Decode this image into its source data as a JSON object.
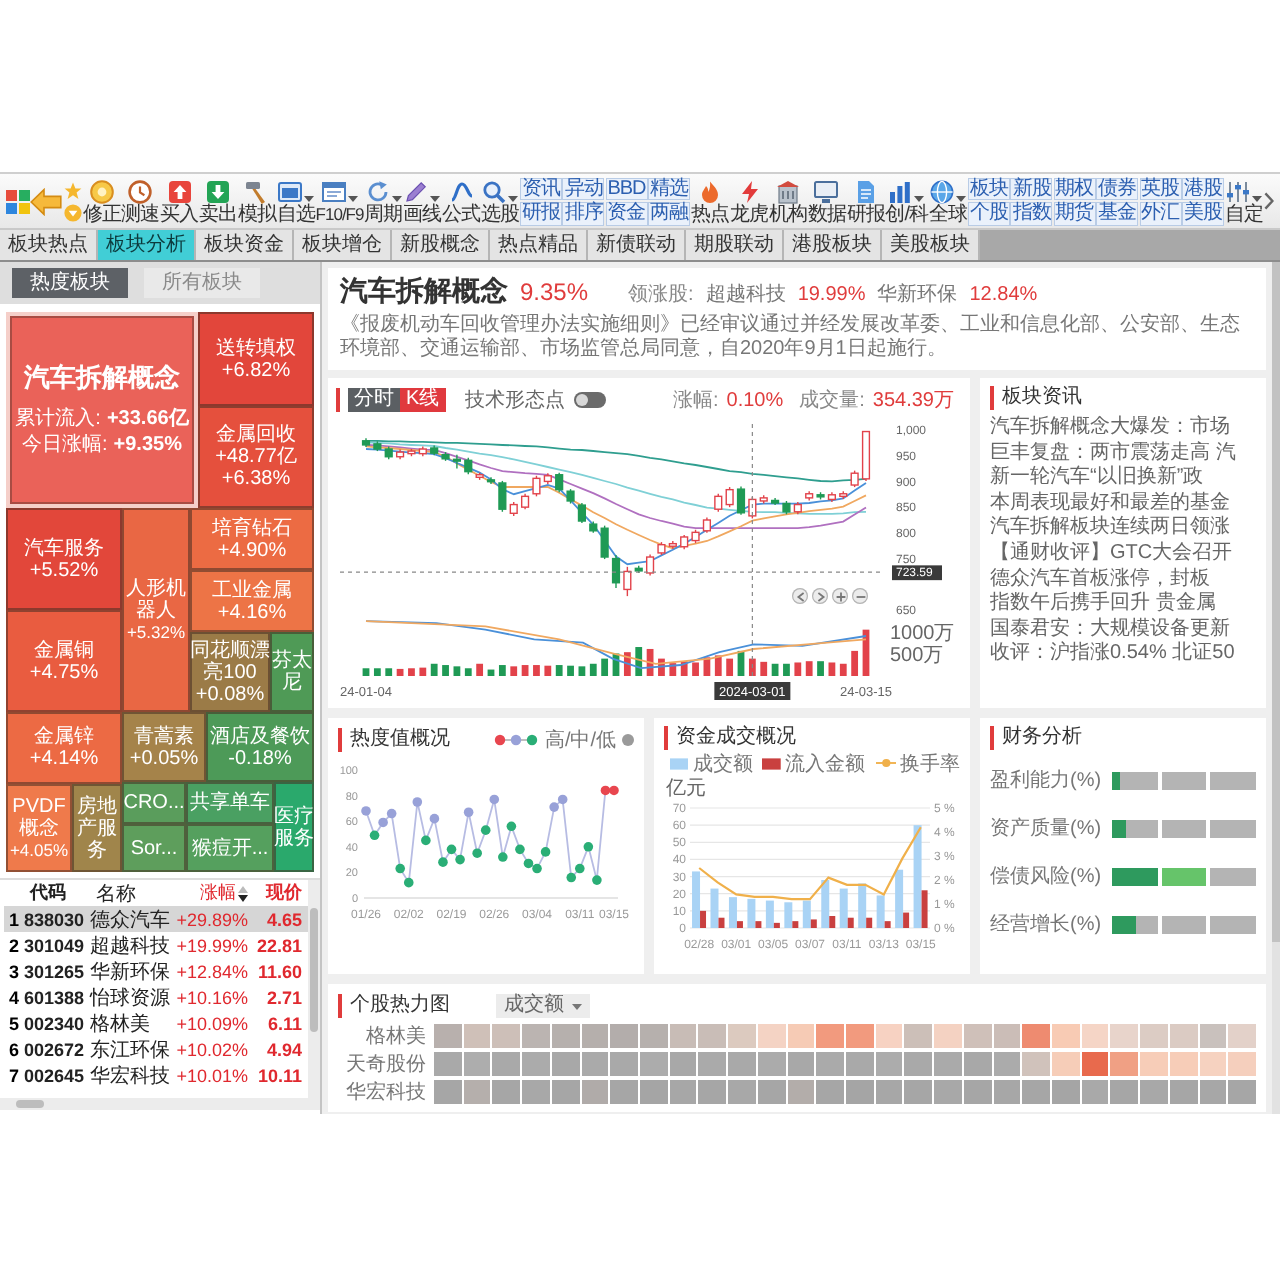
{
  "toolbar": {
    "items": [
      {
        "kind": "tool",
        "label": "修正",
        "menu": false
      },
      {
        "kind": "tool",
        "label": "测速",
        "menu": false
      },
      {
        "kind": "tool",
        "label": "买入",
        "menu": false
      },
      {
        "kind": "tool",
        "label": "卖出",
        "menu": false
      },
      {
        "kind": "tool",
        "label": "模拟",
        "menu": false
      },
      {
        "kind": "tool",
        "label": "自选",
        "menu": true
      },
      {
        "kind": "tool",
        "label": "F10/F9",
        "menu": true
      },
      {
        "kind": "tool",
        "label": "周期",
        "menu": true
      },
      {
        "kind": "tool",
        "label": "画线",
        "menu": true
      },
      {
        "kind": "tool",
        "label": "公式",
        "menu": false
      },
      {
        "kind": "tool",
        "label": "选股",
        "menu": true
      },
      {
        "kind": "pair",
        "labels": [
          "资讯",
          "研报"
        ]
      },
      {
        "kind": "pair",
        "labels": [
          "异动",
          "排序"
        ]
      },
      {
        "kind": "pair",
        "labels": [
          "BBD",
          "资金"
        ]
      },
      {
        "kind": "pair",
        "labels": [
          "精选",
          "两融"
        ]
      },
      {
        "kind": "tool",
        "label": "热点",
        "menu": false
      },
      {
        "kind": "tool",
        "label": "龙虎",
        "menu": false
      },
      {
        "kind": "tool",
        "label": "机构",
        "menu": false
      },
      {
        "kind": "tool",
        "label": "数据",
        "menu": false
      },
      {
        "kind": "tool",
        "label": "研报",
        "menu": false
      },
      {
        "kind": "tool",
        "label": "创/科",
        "menu": true
      },
      {
        "kind": "tool",
        "label": "全球",
        "menu": true
      },
      {
        "kind": "pair",
        "labels": [
          "板块",
          "个股"
        ]
      },
      {
        "kind": "pair",
        "labels": [
          "新股",
          "指数"
        ]
      },
      {
        "kind": "pair",
        "labels": [
          "期权",
          "期货"
        ]
      },
      {
        "kind": "pair",
        "labels": [
          "债券",
          "基金"
        ]
      },
      {
        "kind": "pair",
        "labels": [
          "英股",
          "外汇"
        ]
      },
      {
        "kind": "pair",
        "labels": [
          "港股",
          "美股"
        ]
      },
      {
        "kind": "tool",
        "label": "自定",
        "menu": true
      }
    ]
  },
  "tabs": [
    {
      "label": "板块热点",
      "selected": false
    },
    {
      "label": "板块分析",
      "selected": true
    },
    {
      "label": "板块资金",
      "selected": false
    },
    {
      "label": "板块增仓",
      "selected": false
    },
    {
      "label": "新股概念",
      "selected": false
    },
    {
      "label": "热点精品",
      "selected": false
    },
    {
      "label": "新债联动",
      "selected": false
    },
    {
      "label": "期股联动",
      "selected": false
    },
    {
      "label": "港股板块",
      "selected": false
    },
    {
      "label": "美股板块",
      "selected": false
    }
  ],
  "left_panel": {
    "tabs": [
      {
        "label": "热度板块",
        "selected": true
      },
      {
        "label": "所有板块",
        "selected": false
      }
    ],
    "treemap": [
      {
        "name": "汽车拆解概念",
        "color": "#ea6259",
        "selected": true,
        "stats": [
          {
            "label": "累计流入:",
            "value": "+33.66亿"
          },
          {
            "label": "今日涨幅:",
            "value": "+9.35%"
          }
        ]
      },
      {
        "name": "送转填权",
        "color": "#e2463b",
        "selected": false,
        "values": [
          "+6.82%"
        ]
      },
      {
        "name": "金属回收",
        "color": "#e5503d",
        "selected": false,
        "values": [
          "+48.77亿",
          "+6.38%"
        ]
      },
      {
        "name": "汽车服务",
        "color": "#e2473a",
        "selected": false,
        "values": [
          "+5.52%"
        ]
      },
      {
        "name": "人形机器人",
        "color": "#e96744",
        "selected": false,
        "values": [
          "+5.32%"
        ]
      },
      {
        "name": "培育钻石",
        "color": "#ec6b43",
        "selected": false,
        "values": [
          "+4.90%"
        ]
      },
      {
        "name": "工业金属",
        "color": "#ed7446",
        "selected": false,
        "values": [
          "+4.16%"
        ]
      },
      {
        "name": "金属铜",
        "color": "#e95c40",
        "selected": false,
        "values": [
          "+4.75%"
        ]
      },
      {
        "name": "同花顺漂亮100",
        "color": "#9b7b47",
        "selected": false,
        "values": [
          "+0.08%"
        ]
      },
      {
        "name": "芬太尼",
        "color": "#4f9a56",
        "selected": false
      },
      {
        "name": "金属锌",
        "color": "#ec6a44",
        "selected": false,
        "values": [
          "+4.14%"
        ]
      },
      {
        "name": "青蒿素",
        "color": "#a5834a",
        "selected": false,
        "values": [
          "+0.05%"
        ]
      },
      {
        "name": "酒店及餐饮",
        "color": "#4d9a58",
        "selected": false,
        "values": [
          "-0.18%"
        ]
      },
      {
        "name": "PVDF概念",
        "color": "#ef7a4b",
        "selected": false,
        "values": [
          "+4.05%"
        ]
      },
      {
        "name": "房地产服务",
        "color": "#a0854b",
        "selected": false
      },
      {
        "name": "CRO...",
        "color": "#5a9d5c",
        "selected": false
      },
      {
        "name": "共享单车",
        "color": "#4aa062",
        "selected": false
      },
      {
        "name": "医疗服务",
        "color": "#2aa96c",
        "selected": false
      },
      {
        "name": "Sor...",
        "color": "#5e9e5c",
        "selected": false
      },
      {
        "name": "猴痘开...",
        "color": "#55a05e",
        "selected": false
      }
    ],
    "stocks": {
      "columns": [
        {
          "label": "代码",
          "sorted": false
        },
        {
          "label": "名称",
          "sorted": false
        },
        {
          "label": "涨幅",
          "sorted": true
        },
        {
          "label": "现价",
          "sorted": false
        }
      ],
      "rows": [
        {
          "index": "1",
          "code": "838030",
          "name": "德众汽车",
          "change": "+29.89%",
          "price": "4.65",
          "selected": true
        },
        {
          "index": "2",
          "code": "301049",
          "name": "超越科技",
          "change": "+19.99%",
          "price": "22.81",
          "selected": false
        },
        {
          "index": "3",
          "code": "301265",
          "name": "华新环保",
          "change": "+12.84%",
          "price": "11.60",
          "selected": false
        },
        {
          "index": "4",
          "code": "601388",
          "name": "怡球资源",
          "change": "+10.16%",
          "price": "2.71",
          "selected": false
        },
        {
          "index": "5",
          "code": "002340",
          "name": "格林美",
          "change": "+10.09%",
          "price": "6.11",
          "selected": false
        },
        {
          "index": "6",
          "code": "002672",
          "name": "东江环保",
          "change": "+10.02%",
          "price": "4.94",
          "selected": false
        },
        {
          "index": "7",
          "code": "002645",
          "name": "华宏科技",
          "change": "+10.01%",
          "price": "10.11",
          "selected": false
        }
      ]
    }
  },
  "board": {
    "title": "汽车拆解概念",
    "change": "9.35%",
    "leaders_label": "领涨股:",
    "leaders": [
      {
        "name": "超越科技",
        "change": "19.99%"
      },
      {
        "name": "华新环保",
        "change": "12.84%"
      }
    ],
    "description": "《报废机动车回收管理办法实施细则》已经审议通过并经发展改革委、工业和信息化部、公安部、生态环境部、交通运输部、市场监管总局同意，自2020年9月1日起施行。"
  },
  "kline": {
    "modes": [
      {
        "label": "分时",
        "selected": false
      },
      {
        "label": "K线",
        "selected": true
      }
    ],
    "pattern_toggle": {
      "label": "技术形态点",
      "on": false
    },
    "stats": [
      {
        "label": "涨幅:",
        "value": "0.10%"
      },
      {
        "label": "成交量:",
        "value": "354.39万"
      }
    ],
    "volume_labels": [
      "1000万",
      "500万"
    ],
    "cursor_price": "723.59",
    "cursor_date": "2024-03-01",
    "chart_data": {
      "type": "candlestick",
      "categories": [
        "24-01-04",
        null,
        null,
        null,
        null,
        null,
        null,
        null,
        null,
        null,
        null,
        null,
        null,
        null,
        null,
        null,
        null,
        null,
        null,
        null,
        null,
        null,
        null,
        null,
        null,
        null,
        null,
        null,
        null,
        null,
        null,
        null,
        null,
        null,
        null,
        null,
        null,
        null,
        null,
        null,
        null,
        null,
        null,
        null,
        "24-03-15"
      ],
      "ohlc": [
        [
          979,
          984,
          967,
          971
        ],
        [
          973,
          978,
          959,
          963
        ],
        [
          963,
          968,
          943,
          948
        ],
        [
          948,
          962,
          943,
          957
        ],
        [
          954,
          963,
          949,
          959
        ],
        [
          954,
          968,
          949,
          963
        ],
        [
          965,
          970,
          951,
          955
        ],
        [
          952,
          957,
          940,
          944
        ],
        [
          943,
          952,
          925,
          940
        ],
        [
          941,
          946,
          914,
          919
        ],
        [
          908,
          917,
          903,
          913
        ],
        [
          903,
          908,
          895,
          900
        ],
        [
          897,
          901,
          841,
          846
        ],
        [
          838,
          860,
          833,
          855
        ],
        [
          850,
          876,
          846,
          871
        ],
        [
          876,
          911,
          871,
          906
        ],
        [
          900,
          916,
          895,
          911
        ],
        [
          913,
          917,
          879,
          884
        ],
        [
          881,
          885,
          857,
          862
        ],
        [
          854,
          858,
          819,
          823
        ],
        [
          817,
          822,
          800,
          804
        ],
        [
          809,
          814,
          749,
          753
        ],
        [
          750,
          757,
          693,
          703
        ],
        [
          690,
          734,
          677,
          725
        ],
        [
          731,
          736,
          722,
          726
        ],
        [
          722,
          758,
          717,
          753
        ],
        [
          761,
          782,
          757,
          777
        ],
        [
          774,
          784,
          769,
          779
        ],
        [
          773,
          796,
          768,
          792
        ],
        [
          785,
          806,
          780,
          801
        ],
        [
          804,
          830,
          800,
          825
        ],
        [
          846,
          876,
          841,
          871
        ],
        [
          855,
          889,
          850,
          884
        ],
        [
          885,
          890,
          835,
          839
        ],
        [
          833,
          870,
          828,
          865
        ],
        [
          862,
          873,
          857,
          868
        ],
        [
          863,
          868,
          854,
          858
        ],
        [
          857,
          862,
          836,
          841
        ],
        [
          841,
          860,
          836,
          855
        ],
        [
          868,
          881,
          863,
          876
        ],
        [
          874,
          879,
          865,
          870
        ],
        [
          865,
          879,
          860,
          874
        ],
        [
          871,
          881,
          866,
          876
        ],
        [
          893,
          921,
          889,
          916
        ],
        [
          905,
          998,
          901,
          997
        ]
      ],
      "ylim": [
        650,
        1000
      ],
      "yticks": [
        {
          "value": 1000,
          "label": "1,000"
        },
        {
          "value": 950,
          "label": "950"
        },
        {
          "value": 900,
          "label": "900"
        },
        {
          "value": 850,
          "label": "850"
        },
        {
          "value": 800,
          "label": "800"
        },
        {
          "value": 750,
          "label": "750"
        },
        {
          "value": 650,
          "label": "650"
        }
      ],
      "series": [
        {
          "type": "line",
          "color": "#2f9e8f",
          "values": [
            979,
            979,
            978,
            978,
            977,
            977,
            976,
            975,
            975,
            974,
            973,
            972,
            971,
            970,
            969,
            968,
            966,
            964,
            962,
            961,
            959,
            957,
            955,
            953,
            950,
            946,
            943,
            939,
            935,
            932,
            928,
            924,
            920,
            918,
            915,
            913,
            910,
            908,
            906,
            903,
            901,
            900,
            902,
            903,
            905
          ]
        },
        {
          "type": "line",
          "color": "#7fd0d6",
          "values": [
            976,
            975,
            974,
            972,
            971,
            970,
            969,
            965,
            962,
            958,
            954,
            951,
            947,
            943,
            938,
            933,
            928,
            923,
            918,
            913,
            907,
            901,
            895,
            888,
            882,
            876,
            870,
            865,
            859,
            854,
            849,
            847,
            845,
            843,
            841,
            840,
            840,
            839,
            838,
            837,
            837,
            837,
            838,
            840,
            841
          ]
        },
        {
          "type": "line",
          "color": "#b070c0",
          "values": [
            971,
            970,
            968,
            966,
            964,
            962,
            961,
            955,
            948,
            941,
            933,
            926,
            920,
            918,
            916,
            915,
            913,
            904,
            895,
            886,
            877,
            867,
            856,
            846,
            836,
            829,
            823,
            818,
            812,
            809,
            809,
            809,
            809,
            809,
            809,
            809,
            809,
            809,
            809,
            811,
            814,
            818,
            822,
            836,
            849
          ]
        },
        {
          "type": "line",
          "color": "#f0a860",
          "values": [
            968,
            966,
            965,
            963,
            961,
            959,
            957,
            948,
            935,
            923,
            911,
            899,
            889,
            889,
            889,
            889,
            889,
            878,
            865,
            853,
            840,
            829,
            817,
            806,
            796,
            786,
            777,
            770,
            775,
            779,
            784,
            793,
            803,
            813,
            824,
            828,
            832,
            836,
            839,
            842,
            845,
            847,
            851,
            862,
            873
          ]
        },
        {
          "type": "line",
          "color": "#4a90d9",
          "values": [
            963,
            962,
            960,
            958,
            956,
            955,
            953,
            945,
            936,
            927,
            917,
            904,
            885,
            875,
            881,
            887,
            893,
            886,
            863,
            839,
            816,
            785,
            754,
            739,
            742,
            745,
            756,
            767,
            779,
            792,
            806,
            819,
            833,
            844,
            855,
            857,
            857,
            857,
            857,
            858,
            861,
            863,
            867,
            882,
            897
          ]
        }
      ]
    }
  },
  "news": {
    "title": "板块资讯",
    "items": [
      "汽车拆解概念大爆发：市场",
      "巨丰复盘：两市震荡走高 汽",
      "新一轮汽车“以旧换新”政",
      "本周表现最好和最差的基金",
      "汽车拆解板块连续两日领涨",
      "【通财收评】GTC大会召开",
      "德众汽车首板涨停，封板",
      "指数午后携手回升 贵金属",
      "国泰君安：大规模设备更新",
      "收评：沪指涨0.54% 北证50"
    ]
  },
  "heat": {
    "title": "热度值概况",
    "legend": "高/中/低",
    "chart_data": {
      "type": "line",
      "marker": "circle",
      "categories": [
        "01/26",
        null,
        null,
        null,
        null,
        "02/02",
        null,
        null,
        null,
        null,
        "02/19",
        null,
        null,
        null,
        null,
        "02/26",
        null,
        null,
        null,
        null,
        "03/04",
        null,
        null,
        null,
        null,
        "03/11",
        null,
        null,
        null,
        "03/15"
      ],
      "values": [
        68,
        49,
        59,
        66,
        23,
        12,
        75,
        45,
        62,
        28,
        38,
        30,
        67,
        35,
        53,
        77,
        32,
        56,
        38,
        27,
        23,
        36,
        71,
        77,
        16,
        23,
        40,
        14,
        84,
        84
      ],
      "ylim": [
        0,
        100
      ],
      "yticks": [
        0,
        20,
        40,
        60,
        80,
        100
      ]
    }
  },
  "funds": {
    "title": "资金成交概况",
    "chart_data": {
      "type": "bar",
      "grid": true,
      "ylabel": "亿元",
      "categories": [
        "02/28",
        null,
        "03/01",
        null,
        "03/05",
        null,
        "03/07",
        null,
        "03/11",
        null,
        "03/13",
        null,
        "03/15"
      ],
      "series": [
        {
          "name": "成交额",
          "color": "#a9d3f5",
          "values": [
            33,
            23,
            18,
            17,
            16,
            15,
            16,
            28,
            23,
            26,
            19,
            34,
            60
          ]
        },
        {
          "name": "流入金额",
          "color": "#c9403f",
          "values": [
            10,
            6,
            4,
            4,
            3,
            4,
            5,
            7,
            6,
            6,
            4,
            9,
            22
          ]
        },
        {
          "name": "换手率",
          "color": "#f0b04a",
          "type": "line",
          "axis": "y2",
          "values": [
            2.5,
            1.9,
            1.4,
            1.3,
            1.3,
            1.2,
            1.2,
            2.1,
            1.8,
            1.8,
            1.4,
            2.9,
            4.2
          ]
        }
      ],
      "ylim": [
        0,
        70
      ],
      "yticks": [
        0,
        10,
        20,
        30,
        40,
        50,
        60,
        70
      ],
      "y2lim": [
        0,
        5
      ],
      "y2ticks": [
        {
          "value": 0,
          "label": "0 %"
        },
        {
          "value": 1,
          "label": "1 %"
        },
        {
          "value": 2,
          "label": "2 %"
        },
        {
          "value": 3,
          "label": "3 %"
        },
        {
          "value": 4,
          "label": "4 %"
        },
        {
          "value": 5,
          "label": "5 %"
        }
      ]
    }
  },
  "finance": {
    "title": "财务分析",
    "rows": [
      {
        "label": "盈利能力(%)",
        "level": 0.06
      },
      {
        "label": "资产质量(%)",
        "level": 0.1
      },
      {
        "label": "偿债风险(%)",
        "level": 0.66
      },
      {
        "label": "经营增长(%)",
        "level": 0.17
      }
    ]
  },
  "stock_heat": {
    "title": "个股热力图",
    "metric": "成交额",
    "rows": [
      {
        "name": "格林美",
        "cells": [
          {
            "color": "#b8b0ad"
          },
          {
            "color": "#cfc0b8"
          },
          {
            "color": "#cdbfb8"
          },
          {
            "color": "#bbb4b1"
          },
          {
            "color": "#b6b0ad"
          },
          {
            "color": "#b5afac"
          },
          {
            "color": "#b3adab"
          },
          {
            "color": "#b6b0ad"
          },
          {
            "color": "#c8bcb6"
          },
          {
            "color": "#c9bdb7"
          },
          {
            "color": "#dccabf"
          },
          {
            "color": "#f4d3c4"
          },
          {
            "color": "#f6cbb5"
          },
          {
            "color": "#f29a7e"
          },
          {
            "color": "#f29a7e"
          },
          {
            "color": "#f7d2c2"
          },
          {
            "color": "#ccbfb8"
          },
          {
            "color": "#f4d2c2"
          },
          {
            "color": "#cfc0b9"
          },
          {
            "color": "#cbbdb7"
          },
          {
            "color": "#ee8b70"
          },
          {
            "color": "#f8cbb4"
          },
          {
            "color": "#f5d5c6"
          },
          {
            "color": "#e8d4cb"
          },
          {
            "color": "#dcccc4"
          },
          {
            "color": "#dbcbc3"
          },
          {
            "color": "#c9c1bd"
          },
          {
            "color": "#e3d1c9"
          }
        ]
      },
      {
        "name": "天奇股份",
        "cells": [
          {
            "color": "#a9a9a9"
          },
          {
            "color": "#adadad"
          },
          {
            "color": "#a9a9a9"
          },
          {
            "color": "#ababab"
          },
          {
            "color": "#a8a8a8"
          },
          {
            "color": "#aaaaaa"
          },
          {
            "color": "#a9a9a9"
          },
          {
            "color": "#acacac"
          },
          {
            "color": "#a8a8a8"
          },
          {
            "color": "#aaaaaa"
          },
          {
            "color": "#a9a9a9"
          },
          {
            "color": "#ababab"
          },
          {
            "color": "#a8a8a8"
          },
          {
            "color": "#aaaaaa"
          },
          {
            "color": "#a9a9a9"
          },
          {
            "color": "#acacac"
          },
          {
            "color": "#a9a9a9"
          },
          {
            "color": "#aaaaaa"
          },
          {
            "color": "#a8a8a8"
          },
          {
            "color": "#ababab"
          },
          {
            "color": "#d0c2bb"
          },
          {
            "color": "#f6cdb8"
          },
          {
            "color": "#e86a4d"
          },
          {
            "color": "#f0a084"
          },
          {
            "color": "#f7cdb8"
          },
          {
            "color": "#f7cdb8"
          },
          {
            "color": "#f6d2c0"
          },
          {
            "color": "#f5cfbd"
          }
        ]
      },
      {
        "name": "华宏科技",
        "cells": [
          {
            "color": "#a6a6a6"
          },
          {
            "color": "#b5afac"
          },
          {
            "color": "#a6a6a6"
          },
          {
            "color": "#a8a8a8"
          },
          {
            "color": "#a6a6a6"
          },
          {
            "color": "#b0aba9"
          },
          {
            "color": "#a6a6a6"
          },
          {
            "color": "#a5a5a5"
          },
          {
            "color": "#a7a7a7"
          },
          {
            "color": "#a6a6a6"
          },
          {
            "color": "#a8a8a8"
          },
          {
            "color": "#a6a6a6"
          },
          {
            "color": "#b3adaa"
          },
          {
            "color": "#a6a6a6"
          },
          {
            "color": "#a5a5a5"
          },
          {
            "color": "#a7a7a7"
          },
          {
            "color": "#a6a6a6"
          },
          {
            "color": "#a8a8a8"
          },
          {
            "color": "#a6a6a6"
          },
          {
            "color": "#a7a7a7"
          },
          {
            "color": "#a6a6a6"
          },
          {
            "color": "#a5a5a5"
          },
          {
            "color": "#a9a9a9"
          },
          {
            "color": "#a6a6a6"
          },
          {
            "color": "#a8a8a8"
          },
          {
            "color": "#a6a6a6"
          },
          {
            "color": "#a7a7a7"
          },
          {
            "color": "#a6a6a6"
          }
        ]
      }
    ]
  }
}
